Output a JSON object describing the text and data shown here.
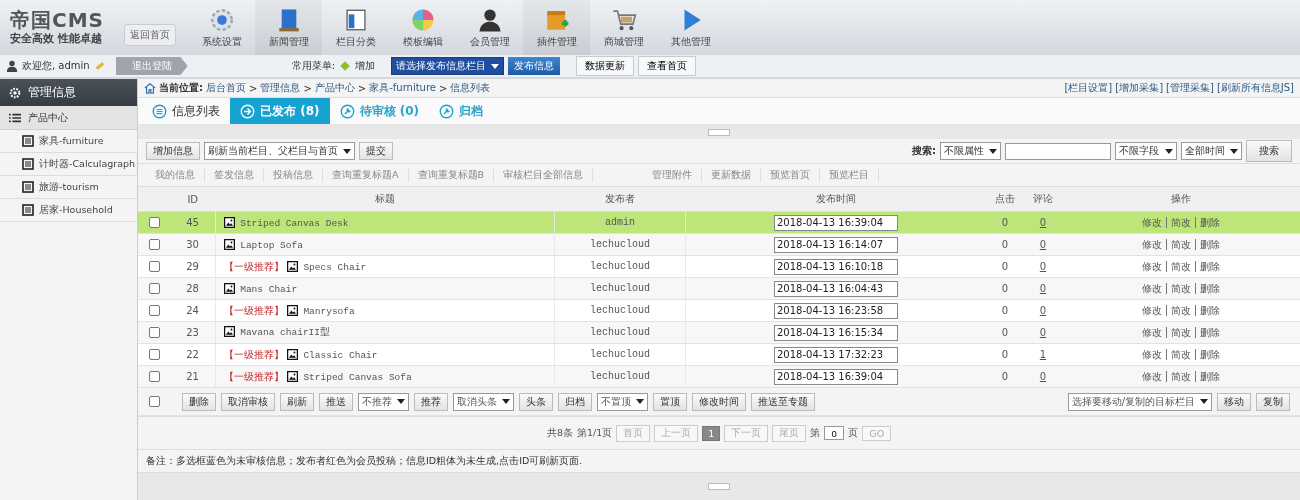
{
  "logo": {
    "title": "帝国CMS",
    "slogan": "安全高效 性能卓越",
    "home_button": "返回首页"
  },
  "nav": [
    {
      "label": "系统设置",
      "selected": false
    },
    {
      "label": "新闻管理",
      "selected": true
    },
    {
      "label": "栏目分类",
      "selected": false
    },
    {
      "label": "模板编辑",
      "selected": false
    },
    {
      "label": "会员管理",
      "selected": false
    },
    {
      "label": "插件管理",
      "selected": true
    },
    {
      "label": "商城管理",
      "selected": false
    },
    {
      "label": "其他管理",
      "selected": false
    }
  ],
  "userbar": {
    "welcome": "欢迎您, admin",
    "logout": "退出登陆",
    "menu_label": "常用菜单:",
    "add": "增加",
    "column_select": "请选择发布信息栏目",
    "publish": "发布信息",
    "update_data": "数据更新",
    "view_home": "查看首页"
  },
  "sidebar": {
    "title": "管理信息",
    "group": "产品中心",
    "items": [
      {
        "label": "家具-furniture",
        "selected": false
      },
      {
        "label": "计时器-Calculagraph",
        "selected": false
      },
      {
        "label": "旅游-tourism",
        "selected": false
      },
      {
        "label": "居家-Household",
        "selected": false
      }
    ]
  },
  "breadcrumb": {
    "label": "当前位置:",
    "items": [
      {
        "text": "后台首页"
      },
      {
        "sep": ">",
        "text": "管理信息"
      },
      {
        "sep": ">",
        "text": "产品中心"
      },
      {
        "sep": ">",
        "text": "家具-furniture"
      },
      {
        "sep": ">",
        "text": "信息列表"
      }
    ],
    "links": [
      "[栏目设置]",
      "[增加采集]",
      "[管理采集]",
      "[刷新所有信息JS]"
    ]
  },
  "tabs": [
    {
      "label": "信息列表",
      "selected": false
    },
    {
      "label": "已发布 (8)",
      "selected": true
    },
    {
      "label": "待审核 (0)",
      "selected": false
    },
    {
      "label": "归档",
      "selected": false
    }
  ],
  "actions": {
    "add": "增加信息",
    "refresh_select": "刷新当前栏目、父栏目与首页",
    "submit": "提交",
    "search_label": "搜索:",
    "attr_select": "不限属性",
    "field_select": "不限字段",
    "time_select": "全部时间",
    "search": "搜索"
  },
  "filters": [
    "我的信息",
    "签发信息",
    "投稿信息",
    "查询重复标题A",
    "查询重复标题B",
    "审核栏目全部信息",
    "管理附件",
    "更新数据",
    "预览首页",
    "预览栏目"
  ],
  "table": {
    "columns": [
      "ID",
      "标题",
      "发布者",
      "发布时间",
      "点击",
      "评论",
      "操作"
    ],
    "rows": [
      {
        "id": "45",
        "title": "Striped Canvas Desk",
        "publisher": "admin",
        "time": "2018-04-13 16:39:04",
        "clicks": "0",
        "comments": "0",
        "selected": true,
        "checked": false,
        "ops": [
          "修改",
          "简改",
          "删除"
        ]
      },
      {
        "id": "30",
        "title": "Laptop Sofa",
        "publisher": "lechucloud",
        "time": "2018-04-13 16:14:07",
        "clicks": "0",
        "comments": "0",
        "selected": false,
        "checked": false,
        "ops": [
          "修改",
          "简改",
          "删除"
        ]
      },
      {
        "id": "29",
        "tag": "【一级推荐】",
        "title": "Specs Chair",
        "publisher": "lechucloud",
        "time": "2018-04-13 16:10:18",
        "clicks": "0",
        "comments": "0",
        "selected": false,
        "checked": false,
        "ops": [
          "修改",
          "简改",
          "删除"
        ]
      },
      {
        "id": "28",
        "title": "Mans Chair",
        "publisher": "lechucloud",
        "time": "2018-04-13 16:04:43",
        "clicks": "0",
        "comments": "0",
        "selected": false,
        "checked": false,
        "ops": [
          "修改",
          "简改",
          "删除"
        ]
      },
      {
        "id": "24",
        "tag": "【一级推荐】",
        "title": "Manrysofa",
        "publisher": "lechucloud",
        "time": "2018-04-13 16:23:58",
        "clicks": "0",
        "comments": "0",
        "selected": false,
        "checked": false,
        "ops": [
          "修改",
          "简改",
          "删除"
        ]
      },
      {
        "id": "23",
        "title": "Mavana chairII型",
        "publisher": "lechucloud",
        "time": "2018-04-13 16:15:34",
        "clicks": "0",
        "comments": "0",
        "selected": false,
        "checked": false,
        "ops": [
          "修改",
          "简改",
          "删除"
        ]
      },
      {
        "id": "22",
        "tag": "【一级推荐】",
        "title": "Classic Chair",
        "publisher": "lechucloud",
        "time": "2018-04-13 17:32:23",
        "clicks": "0",
        "comments": "1",
        "selected": false,
        "checked": false,
        "ops": [
          "修改",
          "简改",
          "删除"
        ]
      },
      {
        "id": "21",
        "tag": "【一级推荐】",
        "title": "Striped Canvas Sofa",
        "publisher": "lechucloud",
        "time": "2018-04-13 16:39:04",
        "clicks": "0",
        "comments": "0",
        "selected": false,
        "checked": false,
        "ops": [
          "修改",
          "简改",
          "删除"
        ]
      }
    ],
    "select_all_checked": false
  },
  "bulk": [
    {
      "kind": "button",
      "label": "删除"
    },
    {
      "kind": "button",
      "label": "取消审核"
    },
    {
      "kind": "button",
      "label": "刷新"
    },
    {
      "kind": "button",
      "label": "推送"
    },
    {
      "kind": "select",
      "label": "不推荐"
    },
    {
      "kind": "button",
      "label": "推荐"
    },
    {
      "kind": "select",
      "label": "取消头条"
    },
    {
      "kind": "button",
      "label": "头条"
    },
    {
      "kind": "button",
      "label": "归档"
    },
    {
      "kind": "select",
      "label": "不置顶"
    },
    {
      "kind": "button",
      "label": "置顶"
    },
    {
      "kind": "button",
      "label": "修改时间"
    },
    {
      "kind": "button",
      "label": "推送至专题"
    }
  ],
  "bulk_right": {
    "target_select": "选择要移动/复制的目标栏目",
    "move": "移动",
    "copy": "复制"
  },
  "pagination": {
    "total": "共8条",
    "page": "第1/1页",
    "first": "首页",
    "prev": "上一页",
    "current": "1",
    "next": "下一页",
    "last": "尾页",
    "goto_label": "第",
    "goto_value": "0",
    "goto_unit": "页",
    "go": "GO"
  },
  "note": "备注：多选框蓝色为未审核信息；发布者红色为会员投稿；信息ID粗体为未生成,点击ID可刷新页面."
}
